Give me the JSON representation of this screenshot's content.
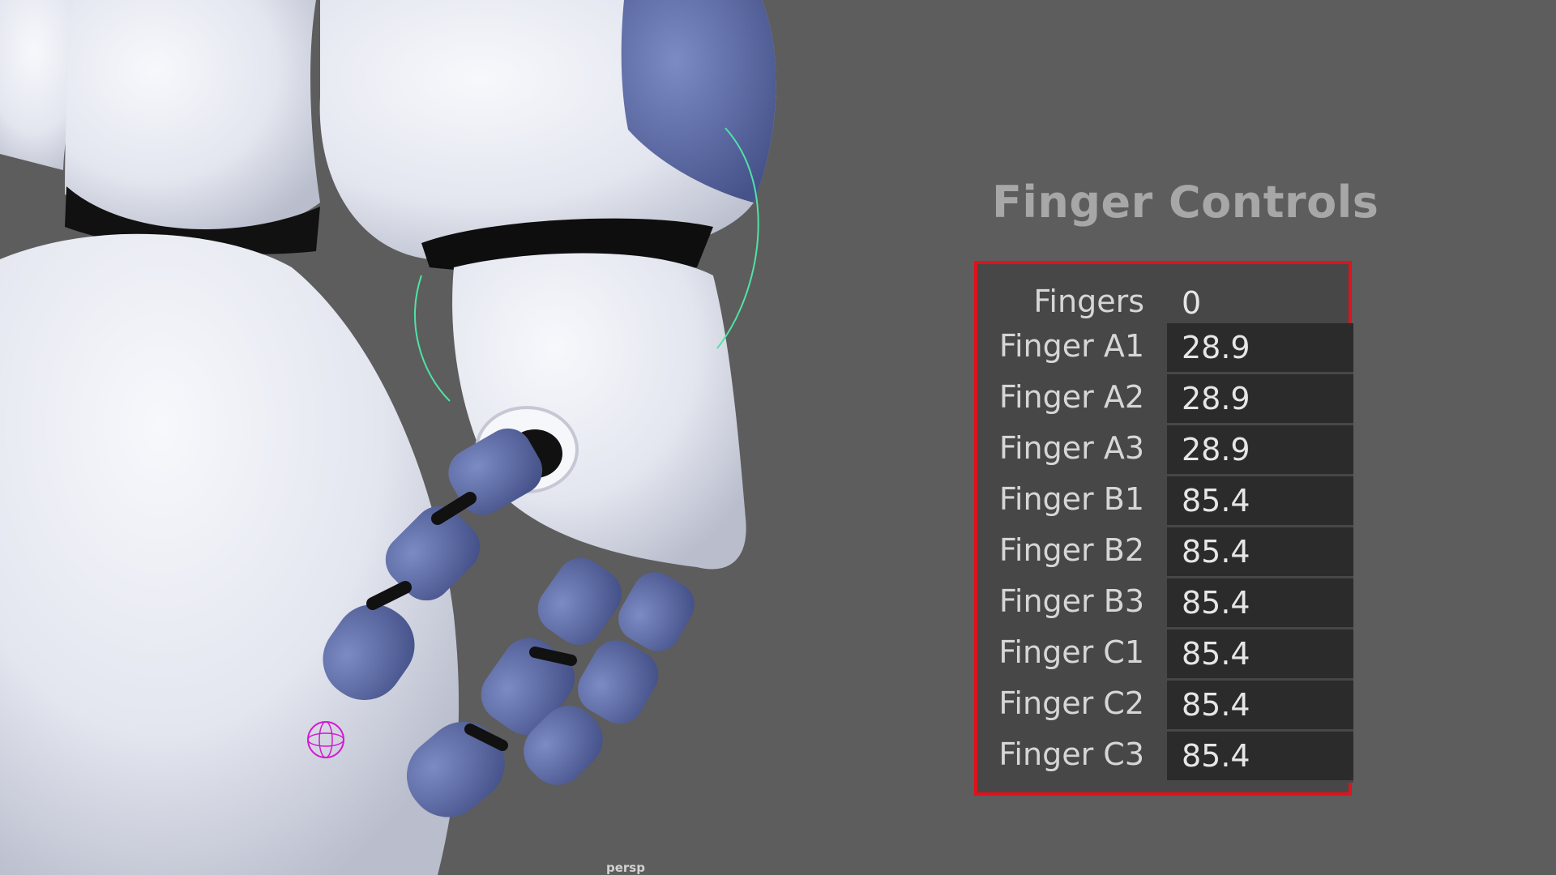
{
  "panel": {
    "title": "Finger Controls",
    "rows": [
      {
        "label": "Fingers",
        "value": "0"
      },
      {
        "label": "Finger A1",
        "value": "28.9"
      },
      {
        "label": "Finger A2",
        "value": "28.9"
      },
      {
        "label": "Finger A3",
        "value": "28.9"
      },
      {
        "label": "Finger B1",
        "value": "85.4"
      },
      {
        "label": "Finger B2",
        "value": "85.4"
      },
      {
        "label": "Finger B3",
        "value": "85.4"
      },
      {
        "label": "Finger C1",
        "value": "85.4"
      },
      {
        "label": "Finger C2",
        "value": "85.4"
      },
      {
        "label": "Finger C3",
        "value": "85.4"
      }
    ]
  },
  "viewport": {
    "camera_label": "persp"
  },
  "colors": {
    "viewport_bg": "#5d5d5d",
    "robot_white": "#e9ebf2",
    "robot_blue": "#5b6aa3",
    "highlight_border": "#e0121c",
    "rotate_ring": "#4ee3a7",
    "locator": "#d21bd2"
  }
}
